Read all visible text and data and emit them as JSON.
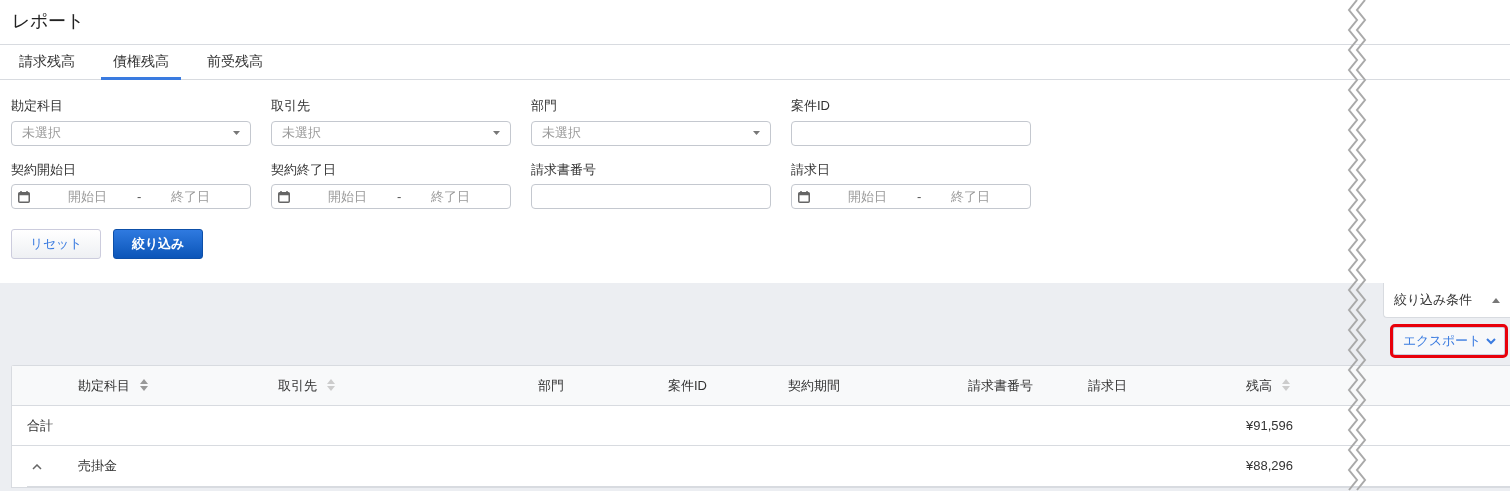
{
  "page": {
    "title": "レポート"
  },
  "tabs": [
    {
      "label": "請求残高",
      "selected": false
    },
    {
      "label": "債権残高",
      "selected": true
    },
    {
      "label": "前受残高",
      "selected": false
    }
  ],
  "filters": [
    {
      "label": "勘定科目",
      "kind": "select",
      "placeholder": "未選択"
    },
    {
      "label": "取引先",
      "kind": "select",
      "placeholder": "未選択"
    },
    {
      "label": "部門",
      "kind": "select",
      "placeholder": "未選択"
    },
    {
      "label": "案件ID",
      "kind": "text"
    },
    {
      "label": "契約開始日",
      "kind": "daterange",
      "start_placeholder": "開始日",
      "separator": "-",
      "end_placeholder": "終了日"
    },
    {
      "label": "契約終了日",
      "kind": "daterange",
      "start_placeholder": "開始日",
      "separator": "-",
      "end_placeholder": "終了日"
    },
    {
      "label": "請求書番号",
      "kind": "text"
    },
    {
      "label": "請求日",
      "kind": "daterange",
      "start_placeholder": "開始日",
      "separator": "-",
      "end_placeholder": "終了日"
    }
  ],
  "buttons": [
    {
      "label": "リセット",
      "kind": "secondary"
    },
    {
      "label": "絞り込み",
      "kind": "primary"
    }
  ],
  "filter_toggle": {
    "label": "絞り込み条件",
    "expanded": true
  },
  "export_button": {
    "label": "エクスポート",
    "highlighted": true
  },
  "table": {
    "columns": [
      {
        "label": "勘定科目",
        "sortable": true,
        "sorted": true
      },
      {
        "label": "取引先",
        "sortable": true,
        "sorted": false
      },
      {
        "label": "部門"
      },
      {
        "label": "案件ID"
      },
      {
        "label": "契約期間"
      },
      {
        "label": "請求書番号"
      },
      {
        "label": "請求日"
      },
      {
        "label": "残高",
        "sortable": true,
        "sorted": false
      }
    ],
    "rows": [
      {
        "kind": "total",
        "label": "合計",
        "balance": "¥91,596"
      },
      {
        "kind": "group",
        "expanded": true,
        "account": "売掛金",
        "balance": "¥88,296"
      }
    ]
  }
}
